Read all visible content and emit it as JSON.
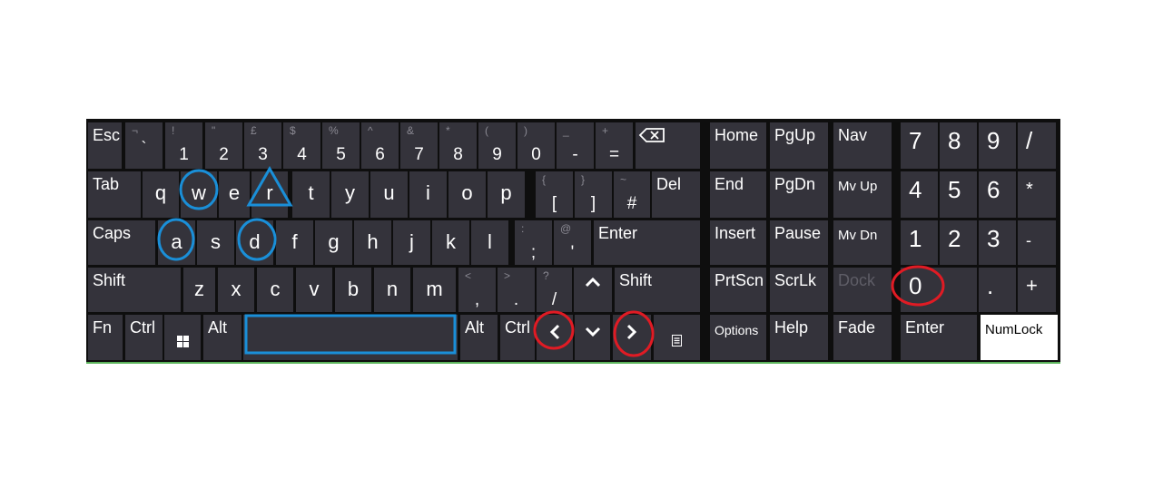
{
  "keyboard": {
    "row1": {
      "esc": "Esc",
      "k1": {
        "sym": "¬",
        "alt": "`"
      },
      "k2": {
        "sym": "!",
        "main": "1"
      },
      "k3": {
        "sym": "\"",
        "main": "2"
      },
      "k4": {
        "sym": "£",
        "main": "3"
      },
      "k5": {
        "sym": "$",
        "main": "4"
      },
      "k6": {
        "sym": "%",
        "main": "5"
      },
      "k7": {
        "sym": "^",
        "main": "6"
      },
      "k8": {
        "sym": "&",
        "main": "7"
      },
      "k9": {
        "sym": "*",
        "main": "8"
      },
      "k10": {
        "sym": "(",
        "main": "9"
      },
      "k11": {
        "sym": ")",
        "main": "0"
      },
      "k12": {
        "sym": "_",
        "main": "-"
      },
      "k13": {
        "sym": "+",
        "main": "="
      },
      "backspace_icon": "backspace-icon"
    },
    "row2": {
      "tab": "Tab",
      "letters": [
        "q",
        "w",
        "e",
        "r",
        "t",
        "y",
        "u",
        "i",
        "o",
        "p"
      ],
      "bracket_open": {
        "sym": "{",
        "main": "["
      },
      "bracket_close": {
        "sym": "}",
        "main": "]"
      },
      "hash": {
        "sym": "~",
        "main": "#"
      },
      "del": "Del"
    },
    "row3": {
      "caps": "Caps",
      "letters": [
        "a",
        "s",
        "d",
        "f",
        "g",
        "h",
        "j",
        "k",
        "l"
      ],
      "semicolon": {
        "sym": ":",
        "main": ";"
      },
      "quote": {
        "sym": "@",
        "main": "'"
      },
      "enter": "Enter"
    },
    "row4": {
      "shift_left": "Shift",
      "letters": [
        "z",
        "x",
        "c",
        "v",
        "b",
        "n",
        "m"
      ],
      "comma": {
        "sym": "<",
        "main": ","
      },
      "period": {
        "sym": ">",
        "main": "."
      },
      "slash": {
        "sym": "?",
        "main": "/"
      },
      "up_icon": "arrow-up-icon",
      "shift_right": "Shift"
    },
    "row5": {
      "fn": "Fn",
      "ctrl_left": "Ctrl",
      "win_icon": "windows-icon",
      "alt_left": "Alt",
      "space": "",
      "alt_right": "Alt",
      "ctrl_right": "Ctrl",
      "left_icon": "arrow-left-icon",
      "down_icon": "arrow-down-icon",
      "right_icon": "arrow-right-icon",
      "menu_icon": "menu-icon"
    }
  },
  "nav": {
    "home": "Home",
    "pgup": "PgUp",
    "nav": "Nav",
    "end": "End",
    "pgdn": "PgDn",
    "mvup": "Mv Up",
    "insert": "Insert",
    "pause": "Pause",
    "mvdn": "Mv Dn",
    "prtscn": "PrtScn",
    "scrlk": "ScrLk",
    "dock": "Dock",
    "options": "Options",
    "help": "Help",
    "fade": "Fade"
  },
  "numpad": {
    "n7": "7",
    "n8": "8",
    "n9": "9",
    "div": "/",
    "n4": "4",
    "n5": "5",
    "n6": "6",
    "mul": "*",
    "n1": "1",
    "n2": "2",
    "n3": "3",
    "sub": "-",
    "n0": "0",
    "dot": ".",
    "add": "+",
    "enter": "Enter",
    "numlock": "NumLock"
  },
  "colors": {
    "key_bg": "#34333b",
    "keyboard_bg": "#0e0e0e",
    "annotation_blue": "#1a8fd8",
    "annotation_red": "#e01b24",
    "numlock_bg": "#ffffff"
  }
}
